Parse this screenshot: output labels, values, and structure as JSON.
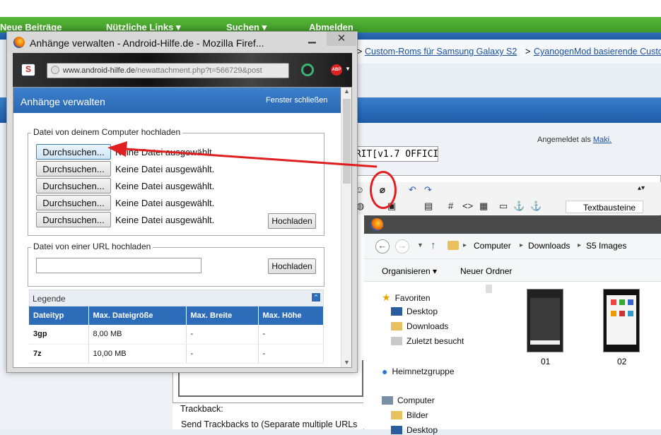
{
  "forum": {
    "nav": [
      "Neue Beiträge",
      "Nützliche Links ▾",
      "Suchen ▾",
      "Abmelden"
    ],
    "breadcrumb": [
      "Custom-Roms für Samsung Galaxy S2",
      "CyanogenMod basierende Custo"
    ],
    "breadcrumb_sep": ">",
    "logged_in_prefix": "Angemeldet als",
    "username": "Maki.",
    "title_input": "IRIT[v1.7 OFFICI",
    "textbausteine": "Textbausteine",
    "trackback_label": "Trackback:",
    "trackback_text": "Send Trackbacks to (Separate multiple URLs"
  },
  "popup": {
    "window_title": "Anhänge verwalten - Android-Hilfe.de - Mozilla Firef...",
    "url_domain": "www.android-hilfe.de",
    "url_path": "/newattachment.php?t=566729&post",
    "header": "Anhänge verwalten",
    "close_link": "Fenster schließen",
    "upload_computer": {
      "legend": "Datei von deinem Computer hochladen",
      "rows": [
        {
          "button": "Durchsuchen...",
          "status": "Keine Datei ausgewählt."
        },
        {
          "button": "Durchsuchen...",
          "status": "Keine Datei ausgewählt."
        },
        {
          "button": "Durchsuchen...",
          "status": "Keine Datei ausgewählt."
        },
        {
          "button": "Durchsuchen...",
          "status": "Keine Datei ausgewählt."
        },
        {
          "button": "Durchsuchen...",
          "status": "Keine Datei ausgewählt."
        }
      ],
      "upload_button": "Hochladen"
    },
    "upload_url": {
      "legend": "Datei von einer URL hochladen",
      "input_value": "",
      "upload_button": "Hochladen"
    },
    "legend_section": {
      "title": "Legende",
      "columns": [
        "Dateityp",
        "Max. Dateigröße",
        "Max. Breite",
        "Max. Höhe"
      ],
      "rows": [
        [
          "3gp",
          "8,00 MB",
          "-",
          "-"
        ],
        [
          "7z",
          "10,00 MB",
          "-",
          "-"
        ]
      ]
    }
  },
  "explorer": {
    "path": [
      "Computer",
      "Downloads",
      "S5 Images"
    ],
    "commands": [
      "Organisieren ▾",
      "Neuer Ordner"
    ],
    "nav_favorites": "Favoriten",
    "nav_items": [
      "Desktop",
      "Downloads",
      "Zuletzt besucht"
    ],
    "nav_homegroup": "Heimnetzgruppe",
    "nav_computer": "Computer",
    "nav_computer_items": [
      "Bilder",
      "Desktop"
    ],
    "files": [
      "01",
      "02"
    ]
  },
  "colors": {
    "forum_green": "#4aa82f",
    "header_blue": "#2a67b2",
    "annotation_red": "#e02020"
  }
}
